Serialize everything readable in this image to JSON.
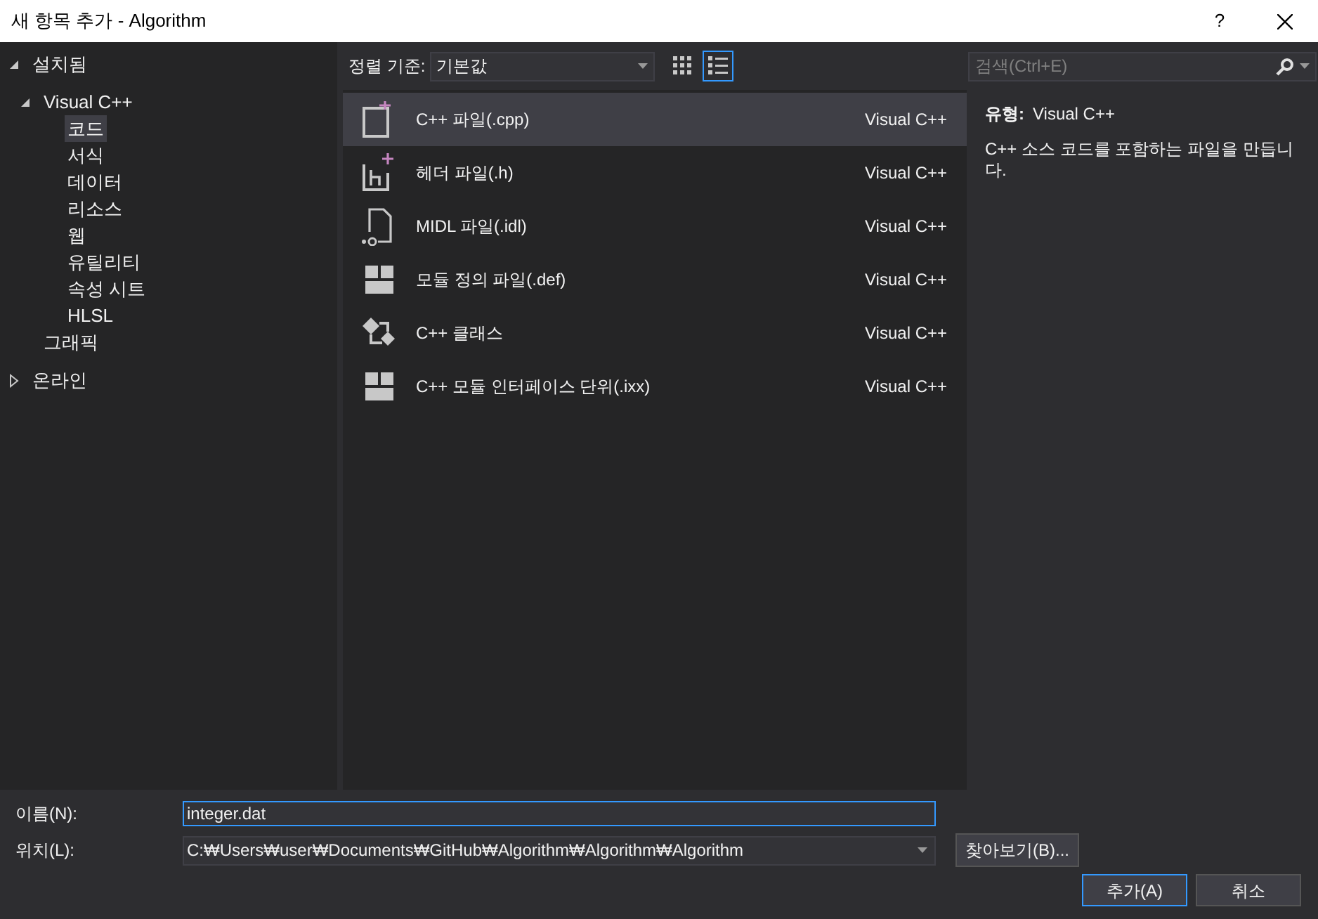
{
  "window": {
    "title": "새 항목 추가 - Algorithm",
    "help": "?"
  },
  "tree": [
    {
      "label": "설치됨",
      "expanded": true,
      "selected": false,
      "children": [
        {
          "label": "Visual C++",
          "expanded": true,
          "selected": false,
          "children": [
            {
              "label": "코드",
              "selected": true
            },
            {
              "label": "서식",
              "selected": false
            },
            {
              "label": "데이터",
              "selected": false
            },
            {
              "label": "리소스",
              "selected": false
            },
            {
              "label": "웹",
              "selected": false
            },
            {
              "label": "유틸리티",
              "selected": false
            },
            {
              "label": "속성 시트",
              "selected": false
            },
            {
              "label": "HLSL",
              "selected": false
            }
          ]
        },
        {
          "label": "그래픽",
          "selected": false
        }
      ]
    },
    {
      "label": "온라인",
      "expanded": false,
      "selected": false
    }
  ],
  "toolbar": {
    "sort_label": "정렬 기준:",
    "sort_value": "기본값",
    "view_modes": [
      {
        "kind": "grid",
        "selected": false
      },
      {
        "kind": "list",
        "selected": true
      }
    ]
  },
  "search": {
    "placeholder": "검색(Ctrl+E)"
  },
  "templates": [
    {
      "kind": "cpp",
      "name": "C++ 파일(.cpp)",
      "language": "Visual C++",
      "selected": true
    },
    {
      "kind": "header",
      "name": "헤더 파일(.h)",
      "language": "Visual C++",
      "selected": false
    },
    {
      "kind": "idl",
      "name": "MIDL 파일(.idl)",
      "language": "Visual C++",
      "selected": false
    },
    {
      "kind": "module",
      "name": "모듈 정의 파일(.def)",
      "language": "Visual C++",
      "selected": false
    },
    {
      "kind": "class",
      "name": "C++ 클래스",
      "language": "Visual C++",
      "selected": false
    },
    {
      "kind": "module",
      "name": "C++ 모듈 인터페이스 단위(.ixx)",
      "language": "Visual C++",
      "selected": false
    }
  ],
  "details": {
    "type_label": "유형:",
    "type_value": "Visual C++",
    "description": "C++ 소스 코드를 포함하는 파일을 만듭니다."
  },
  "form": {
    "name_label": "이름(N):",
    "name_value": "integer.dat",
    "location_label": "위치(L):",
    "location_value": "C:₩Users₩user₩Documents₩GitHub₩Algorithm₩Algorithm₩Algorithm",
    "browse": "찾아보기(B)..."
  },
  "buttons": [
    {
      "label": "추가(A)",
      "kind": "primary"
    },
    {
      "label": "취소",
      "kind": "secondary"
    }
  ]
}
